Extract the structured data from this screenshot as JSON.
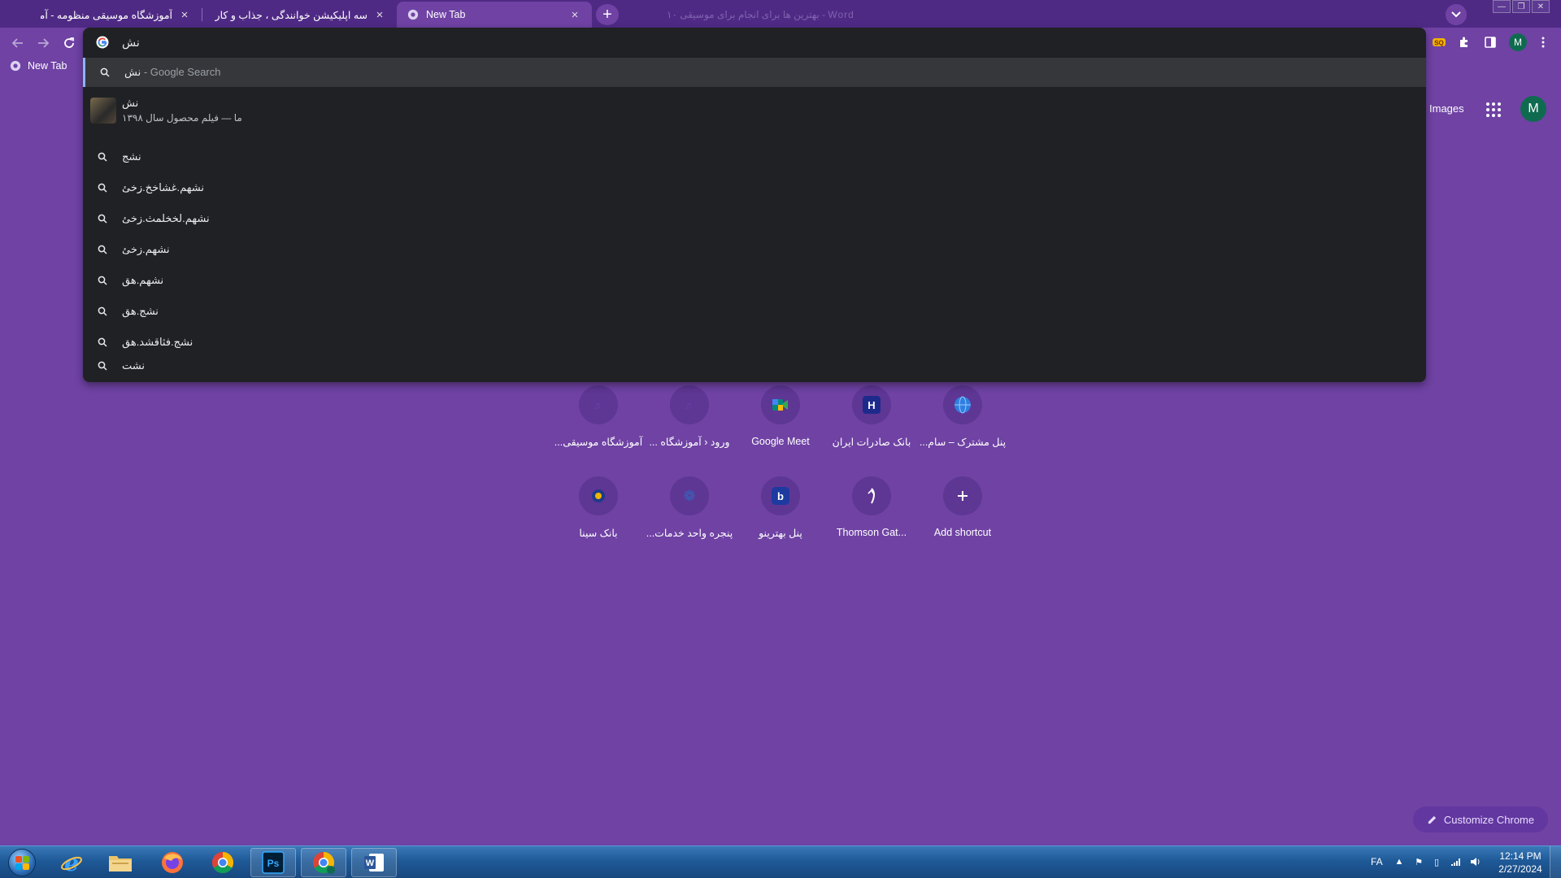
{
  "tabs": [
    {
      "title": "آموزشگاه موسیقی منظومه - آموزشگاه موسیقی",
      "active": false
    },
    {
      "title": "سه اپلیکیشن خوانندگی ، جذاب و کاربردی !",
      "active": false
    },
    {
      "title": "New Tab",
      "active": true
    }
  ],
  "blurred_window_title": "۱۰ بهترین ها برای انجام برای موسیقی - Word",
  "bookmarks": [
    {
      "label": "New Tab"
    }
  ],
  "omnibox": {
    "query": "نش",
    "top_suggestion": {
      "query": "نش",
      "suffix": " - Google Search"
    },
    "entity": {
      "title": "نش",
      "subtitle": "ما — فیلم محصول سال ۱۳۹۸"
    },
    "suggestions": [
      "نشج",
      "نشهم.غشاخخ.زخئ",
      "نشهم.لخخلمث.زخئ",
      "نشهم.زخئ",
      "نشهم.هق",
      "نشج.هق",
      "نشج.فثاقشد.هق",
      "نشت"
    ]
  },
  "ntp": {
    "images_label": "Images",
    "avatar_letter": "M",
    "shortcuts_row1": [
      {
        "label": "آموزشگاه موسیقی...",
        "icon": "music-school-icon",
        "color": "#6a3fa8"
      },
      {
        "label": "ورود ‹ آموزشگاه ...",
        "icon": "music-school-icon",
        "color": "#6a3fa8"
      },
      {
        "label": "Google Meet",
        "icon": "google-meet-icon",
        "color": "#00897b"
      },
      {
        "label": "بانک صادرات ایران",
        "icon": "bank-saderat-icon",
        "color": "#1d2a8c"
      },
      {
        "label": "پنل مشترک – سام...",
        "icon": "globe-icon",
        "color": "#2f7fe0"
      }
    ],
    "shortcuts_row2": [
      {
        "label": "بانک سینا",
        "icon": "bank-sina-icon",
        "color": "#f0b400"
      },
      {
        "label": "پنجره واحد خدمات...",
        "icon": "emblem-icon",
        "color": "#3a62b8"
      },
      {
        "label": "پنل بهترینو",
        "icon": "behtarino-icon",
        "color": "#1d3aa0"
      },
      {
        "label": "Thomson Gat...",
        "icon": "thomson-icon",
        "color": "#ffffff"
      },
      {
        "label": "Add shortcut",
        "icon": "plus-icon",
        "color": "#ffffff"
      }
    ],
    "customize_label": "Customize Chrome"
  },
  "toolbar": {
    "profile_letter": "M"
  },
  "taskbar": {
    "apps": [
      "internet-explorer-icon",
      "file-explorer-icon",
      "firefox-icon",
      "chrome-icon",
      "photoshop-icon",
      "chrome-profile-icon",
      "word-icon"
    ],
    "language": "FA",
    "time": "12:14 PM",
    "date": "2/27/2024"
  }
}
